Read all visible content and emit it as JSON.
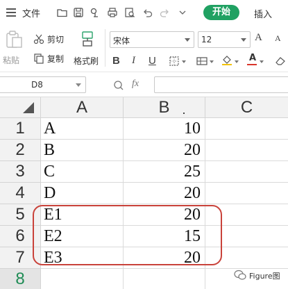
{
  "menubar": {
    "file_label": "文件",
    "start_tab": "开始",
    "insert_tab": "插入"
  },
  "ribbon": {
    "paste_label": "粘贴",
    "cut_label": "剪切",
    "copy_label": "复制",
    "format_painter_label": "格式刷",
    "font_name": "宋体",
    "font_size": "12",
    "bold": "B",
    "italic": "I",
    "underline": "U",
    "grow_font": "A",
    "shrink_font": "A",
    "font_color_glyph": "A"
  },
  "formula_bar": {
    "cell_ref": "D8",
    "fx_label": "fx",
    "value": ""
  },
  "sheet": {
    "columns": [
      "A",
      "B",
      "C"
    ],
    "rows": [
      {
        "num": "1",
        "a": "A",
        "b": "10"
      },
      {
        "num": "2",
        "a": "B",
        "b": "20"
      },
      {
        "num": "3",
        "a": "C",
        "b": "25"
      },
      {
        "num": "4",
        "a": "D",
        "b": "20"
      },
      {
        "num": "5",
        "a": "E1",
        "b": "20"
      },
      {
        "num": "6",
        "a": "E2",
        "b": "15"
      },
      {
        "num": "7",
        "a": "E3",
        "b": "20"
      },
      {
        "num": "8",
        "a": "",
        "b": ""
      }
    ],
    "active_row": "8",
    "highlight_color": "#c9423a"
  },
  "colors": {
    "accent_green": "#20a162",
    "active_row_number": "#1f8c55"
  },
  "watermark": {
    "text": "Figure图"
  },
  "icons": [
    "menu-icon",
    "open-folder-icon",
    "save-icon",
    "export-icon",
    "print-icon",
    "print-preview-icon",
    "undo-icon",
    "redo-icon",
    "dropdown-icon",
    "paste-icon",
    "cut-icon",
    "copy-icon",
    "format-painter-icon",
    "border-icon",
    "cell-style-icon",
    "fill-color-icon",
    "font-color-icon",
    "eraser-icon",
    "zoom-icon",
    "select-all-icon",
    "wechat-icon"
  ]
}
